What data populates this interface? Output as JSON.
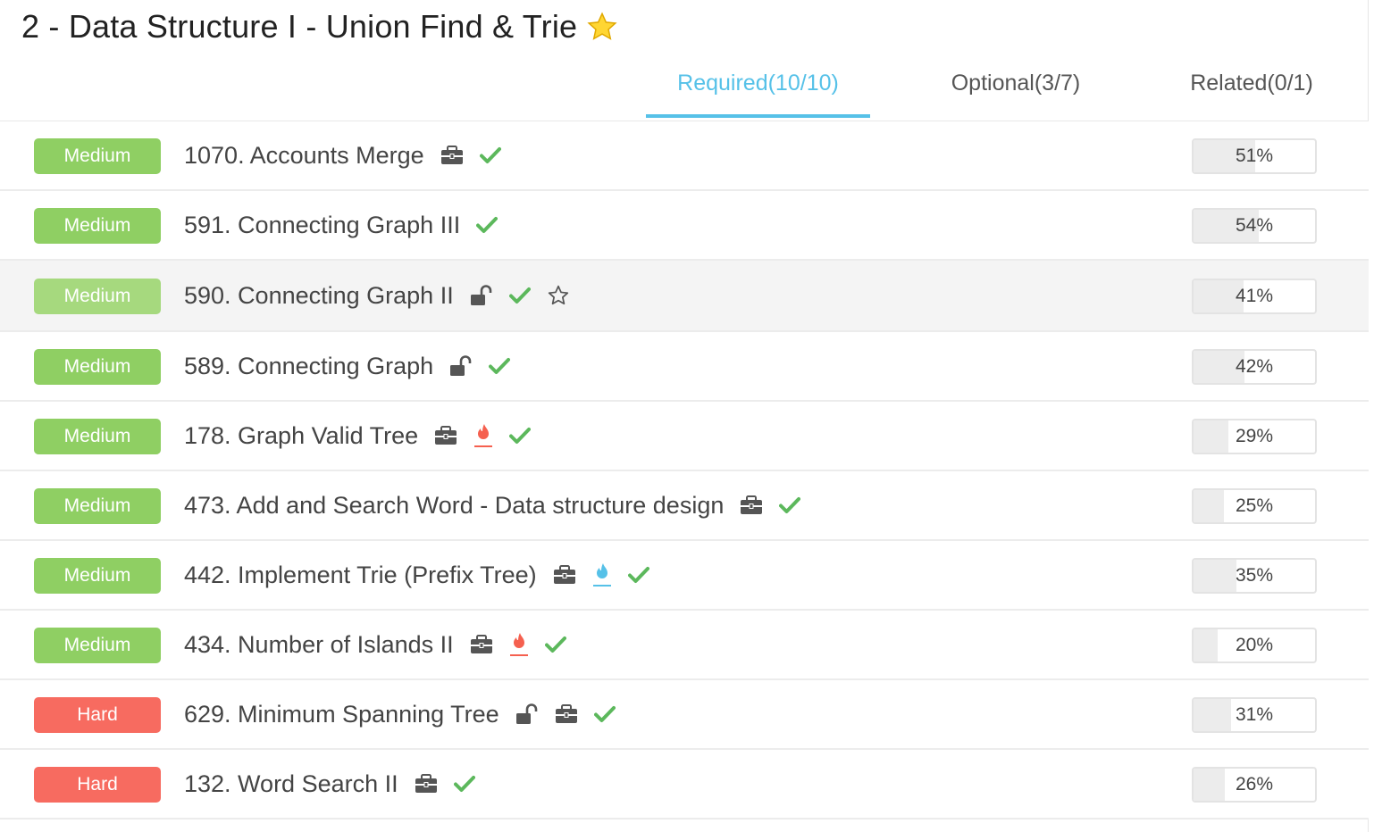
{
  "header": {
    "title": "2 - Data Structure I - Union Find & Trie"
  },
  "tabs": [
    {
      "label": "Required(10/10)",
      "active": true
    },
    {
      "label": "Optional(3/7)",
      "active": false
    },
    {
      "label": "Related(0/1)",
      "active": false
    }
  ],
  "colors": {
    "accent": "#56c1e8",
    "medium": "#8fcf63",
    "hard": "#f76b60",
    "check": "#5cb85c",
    "flame_red": "#f5604f",
    "flame_blue": "#56c1e8"
  },
  "problems": [
    {
      "difficulty": "Medium",
      "name": "1070. Accounts Merge",
      "icons": [
        "briefcase-icon",
        "check-icon"
      ],
      "acceptance": "51%",
      "acceptance_value": 0.51
    },
    {
      "difficulty": "Medium",
      "name": "591. Connecting Graph III",
      "icons": [
        "check-icon"
      ],
      "acceptance": "54%",
      "acceptance_value": 0.54
    },
    {
      "difficulty": "Medium",
      "name": "590. Connecting Graph II",
      "icons": [
        "unlock-icon",
        "check-icon",
        "star-outline-icon"
      ],
      "acceptance": "41%",
      "acceptance_value": 0.41,
      "hovered": true
    },
    {
      "difficulty": "Medium",
      "name": "589. Connecting Graph",
      "icons": [
        "unlock-icon",
        "check-icon"
      ],
      "acceptance": "42%",
      "acceptance_value": 0.42
    },
    {
      "difficulty": "Medium",
      "name": "178. Graph Valid Tree",
      "icons": [
        "briefcase-icon",
        "flame-red-icon",
        "check-icon"
      ],
      "acceptance": "29%",
      "acceptance_value": 0.29
    },
    {
      "difficulty": "Medium",
      "name": "473. Add and Search Word - Data structure design",
      "icons": [
        "briefcase-icon",
        "check-icon"
      ],
      "acceptance": "25%",
      "acceptance_value": 0.25
    },
    {
      "difficulty": "Medium",
      "name": "442. Implement Trie (Prefix Tree)",
      "icons": [
        "briefcase-icon",
        "flame-blue-icon",
        "check-icon"
      ],
      "acceptance": "35%",
      "acceptance_value": 0.35
    },
    {
      "difficulty": "Medium",
      "name": "434. Number of Islands II",
      "icons": [
        "briefcase-icon",
        "flame-red-icon",
        "check-icon"
      ],
      "acceptance": "20%",
      "acceptance_value": 0.2
    },
    {
      "difficulty": "Hard",
      "name": "629. Minimum Spanning Tree",
      "icons": [
        "unlock-icon",
        "briefcase-icon",
        "check-icon"
      ],
      "acceptance": "31%",
      "acceptance_value": 0.31
    },
    {
      "difficulty": "Hard",
      "name": "132. Word Search II",
      "icons": [
        "briefcase-icon",
        "check-icon"
      ],
      "acceptance": "26%",
      "acceptance_value": 0.26
    }
  ]
}
